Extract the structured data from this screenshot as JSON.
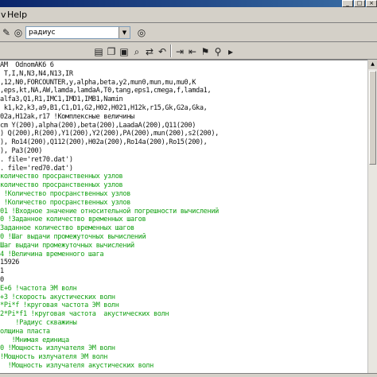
{
  "menubar": {
    "view_label": "v",
    "help_label": "Help"
  },
  "toolbar": {
    "combo_value": "радиус"
  },
  "colors": {
    "comment": "#12a012",
    "code": "#111111",
    "title_bar": "#0a246a"
  },
  "icons": {
    "toolbar1": [
      "edit-icon",
      "binoculars-icon",
      "binoculars-icon"
    ],
    "toolbar2": [
      "document-icon",
      "copy-icon",
      "paste-icon",
      "find-icon",
      "replace-icon",
      "undo-icon",
      "redo-icon",
      "indent-icon",
      "outdent-icon",
      "bookmark-icon",
      "comment-icon",
      "help-icon",
      "pin-icon",
      "run-icon"
    ]
  },
  "editor": {
    "lines": [
      {
        "text": "AM  OdnomAK6 6",
        "type": "code"
      },
      {
        "text": " T,I,N,N3,N4,N13,IR",
        "type": "code"
      },
      {
        "text": ",12,N0,FORCOUNTER,y,alpha,beta,y2,mun0,mun,mu,mu0,K",
        "type": "code"
      },
      {
        "text": ",eps,kt,NA,AW,lamda,lamdaA,T0,tang,eps1,cmega,f,lamda1,",
        "type": "code"
      },
      {
        "text": "alfa3,Q1,R1,IMC1,IMD1,IMB1,Namin",
        "type": "code"
      },
      {
        "text": " k1,k2,k3,a9,B1,C1,D1,G2,H02,H021,H12k,r15,Gk,G2a,Gka,",
        "type": "code"
      },
      {
        "text": "02a,H12ak,r17 !Комплексные величины",
        "type": "code"
      },
      {
        "text": "cm Y(200),alpha(200),beta(200),LaadaA(200),Q11(200)",
        "type": "code"
      },
      {
        "text": ") Q(200),R(200),Y1(200),Y2(200),PA(200),mun(200),s2(200),",
        "type": "code"
      },
      {
        "text": "), Ro14(200),Q112(200),H02a(200),Ro14a(200),Ro15(200),",
        "type": "code"
      },
      {
        "text": "), Pa3(200)",
        "type": "code"
      },
      {
        "text": ". file='ret70.dat')",
        "type": "code"
      },
      {
        "text": ". file='red70.dat')",
        "type": "code"
      },
      {
        "text": "количество просранственных узлов",
        "type": "cmt"
      },
      {
        "text": "количество просранственных узлов",
        "type": "cmt"
      },
      {
        "text": " !Количество просранственных узлов",
        "type": "cmt"
      },
      {
        "text": " !Количество просранственных узлов",
        "type": "cmt"
      },
      {
        "text": "01 !Входное значение относительной погрешности вычислений",
        "type": "cmt"
      },
      {
        "text": "0 !Заданное количество временных шагов",
        "type": "cmt"
      },
      {
        "text": "Заданное количество временных шагов",
        "type": "cmt"
      },
      {
        "text": "0 !Шаг выдачи промежуточных вычислений",
        "type": "cmt"
      },
      {
        "text": "Шаг выдачи промежуточных вычислений",
        "type": "cmt"
      },
      {
        "text": "4 !Величина временного шага",
        "type": "cmt"
      },
      {
        "text": "15926",
        "type": "code"
      },
      {
        "text": "1",
        "type": "code"
      },
      {
        "text": "0",
        "type": "code"
      },
      {
        "text": "E+6 !частота ЭМ волн",
        "type": "cmt"
      },
      {
        "text": "+3 !скорость акустических волн",
        "type": "cmt"
      },
      {
        "text": "*Pi*f !круговая частота ЭМ волн",
        "type": "cmt"
      },
      {
        "text": "2*Pi*f1 !круговая частота  акустических волн",
        "type": "cmt"
      },
      {
        "text": "    !Радиус скважины",
        "type": "cmt"
      },
      {
        "text": "олщина пласта",
        "type": "cmt"
      },
      {
        "text": "   !Мнимая единица",
        "type": "cmt"
      },
      {
        "text": "0 !Мощность излучателя ЭМ волн",
        "type": "cmt"
      },
      {
        "text": "!Мощность излучателя ЭМ волн",
        "type": "cmt"
      },
      {
        "text": "  !Мощность излучателя акустических волн",
        "type": "cmt"
      }
    ]
  }
}
